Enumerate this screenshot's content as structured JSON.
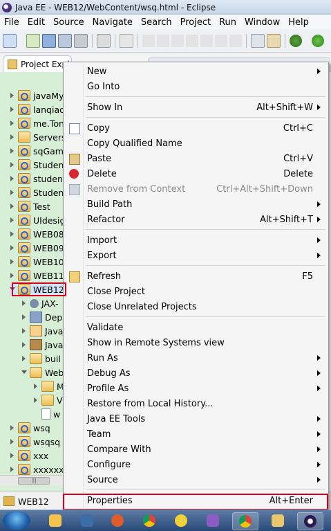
{
  "window": {
    "title": "Java EE - WEB12/WebContent/wsq.html - Eclipse"
  },
  "menubar": [
    "File",
    "Edit",
    "Source",
    "Navigate",
    "Search",
    "Project",
    "Run",
    "Window",
    "Help"
  ],
  "view_tab": {
    "label": "Project Expl"
  },
  "tree": [
    {
      "label": "javaMy",
      "type": "project",
      "indent": 0,
      "expanded": false
    },
    {
      "label": "lanqiao",
      "type": "project",
      "indent": 0,
      "expanded": false
    },
    {
      "label": "me.Ton",
      "type": "project",
      "indent": 0,
      "expanded": false
    },
    {
      "label": "Servers",
      "type": "folder",
      "indent": 0,
      "expanded": false
    },
    {
      "label": "sqGam",
      "type": "project",
      "indent": 0,
      "expanded": false
    },
    {
      "label": "Student",
      "type": "project",
      "indent": 0,
      "expanded": false
    },
    {
      "label": "student",
      "type": "project",
      "indent": 0,
      "expanded": false
    },
    {
      "label": "Student",
      "type": "project",
      "indent": 0,
      "expanded": false
    },
    {
      "label": "Test",
      "type": "project",
      "indent": 0,
      "expanded": false
    },
    {
      "label": "UIdesig",
      "type": "project",
      "indent": 0,
      "expanded": false
    },
    {
      "label": "WEB08",
      "type": "project",
      "indent": 0,
      "expanded": false
    },
    {
      "label": "WEB09",
      "type": "project",
      "indent": 0,
      "expanded": false
    },
    {
      "label": "WEB10",
      "type": "project",
      "indent": 0,
      "expanded": false
    },
    {
      "label": "WEB11",
      "type": "project",
      "indent": 0,
      "expanded": false
    },
    {
      "label": "WEB12",
      "type": "project",
      "indent": 0,
      "expanded": true,
      "selected": true
    },
    {
      "label": "JAX-",
      "type": "gear",
      "indent": 1,
      "expanded": false
    },
    {
      "label": "Dep",
      "type": "dd",
      "indent": 1,
      "expanded": false
    },
    {
      "label": "Java",
      "type": "java",
      "indent": 1,
      "expanded": false
    },
    {
      "label": "Java",
      "type": "lib",
      "indent": 1,
      "expanded": false
    },
    {
      "label": "buil",
      "type": "folder",
      "indent": 1,
      "expanded": false
    },
    {
      "label": "Web",
      "type": "folder",
      "indent": 1,
      "expanded": true
    },
    {
      "label": "M",
      "type": "folder",
      "indent": 2,
      "expanded": false
    },
    {
      "label": "V",
      "type": "folder",
      "indent": 2,
      "expanded": false
    },
    {
      "label": "w",
      "type": "file",
      "indent": 2,
      "expanded": null
    },
    {
      "label": "wsq",
      "type": "project",
      "indent": 0,
      "expanded": false
    },
    {
      "label": "wsqsq",
      "type": "project",
      "indent": 0,
      "expanded": false
    },
    {
      "label": "xxx",
      "type": "project",
      "indent": 0,
      "expanded": false
    },
    {
      "label": "xxxxxx",
      "type": "project",
      "indent": 0,
      "expanded": false
    }
  ],
  "status": {
    "label": "WEB12"
  },
  "context_menu": [
    {
      "label": "New",
      "accel": "",
      "submenu": true,
      "icon": ""
    },
    {
      "label": "Go Into",
      "accel": "",
      "submenu": false,
      "icon": ""
    },
    {
      "sep": true
    },
    {
      "label": "Show In",
      "accel": "Alt+Shift+W",
      "submenu": true,
      "icon": ""
    },
    {
      "sep": true
    },
    {
      "label": "Copy",
      "accel": "Ctrl+C",
      "submenu": false,
      "icon": "copy-icon"
    },
    {
      "label": "Copy Qualified Name",
      "accel": "",
      "submenu": false,
      "icon": ""
    },
    {
      "label": "Paste",
      "accel": "Ctrl+V",
      "submenu": false,
      "icon": "paste-icon"
    },
    {
      "label": "Delete",
      "accel": "Delete",
      "submenu": false,
      "icon": "delete-icon"
    },
    {
      "label": "Remove from Context",
      "accel": "Ctrl+Alt+Shift+Down",
      "submenu": false,
      "icon": "remove-context-icon",
      "disabled": true
    },
    {
      "label": "Build Path",
      "accel": "",
      "submenu": true,
      "icon": ""
    },
    {
      "label": "Refactor",
      "accel": "Alt+Shift+T",
      "submenu": true,
      "icon": ""
    },
    {
      "sep": true
    },
    {
      "label": "Import",
      "accel": "",
      "submenu": true,
      "icon": ""
    },
    {
      "label": "Export",
      "accel": "",
      "submenu": true,
      "icon": ""
    },
    {
      "sep": true
    },
    {
      "label": "Refresh",
      "accel": "F5",
      "submenu": false,
      "icon": "refresh-icon"
    },
    {
      "label": "Close Project",
      "accel": "",
      "submenu": false,
      "icon": ""
    },
    {
      "label": "Close Unrelated Projects",
      "accel": "",
      "submenu": false,
      "icon": ""
    },
    {
      "sep": true
    },
    {
      "label": "Validate",
      "accel": "",
      "submenu": false,
      "icon": ""
    },
    {
      "label": "Show in Remote Systems view",
      "accel": "",
      "submenu": false,
      "icon": ""
    },
    {
      "label": "Run As",
      "accel": "",
      "submenu": true,
      "icon": ""
    },
    {
      "label": "Debug As",
      "accel": "",
      "submenu": true,
      "icon": ""
    },
    {
      "label": "Profile As",
      "accel": "",
      "submenu": true,
      "icon": ""
    },
    {
      "label": "Restore from Local History...",
      "accel": "",
      "submenu": false,
      "icon": ""
    },
    {
      "label": "Java EE Tools",
      "accel": "",
      "submenu": true,
      "icon": ""
    },
    {
      "label": "Team",
      "accel": "",
      "submenu": true,
      "icon": ""
    },
    {
      "label": "Compare With",
      "accel": "",
      "submenu": true,
      "icon": ""
    },
    {
      "label": "Configure",
      "accel": "",
      "submenu": true,
      "icon": ""
    },
    {
      "label": "Source",
      "accel": "",
      "submenu": true,
      "icon": ""
    },
    {
      "sep": true
    },
    {
      "label": "Properties",
      "accel": "Alt+Enter",
      "submenu": false,
      "icon": "",
      "highlighted": true
    }
  ],
  "taskbar": [
    "start-button",
    "task-app-1",
    "task-app-2",
    "task-app-3",
    "task-chrome-1",
    "task-app-5",
    "task-app-6",
    "task-chrome-2",
    "task-explorer",
    "task-eclipse"
  ],
  "colors": {
    "highlight_box": "#d8001c",
    "explorer_bg": "#d7eed7",
    "menu_bg": "#f5f5f5"
  }
}
